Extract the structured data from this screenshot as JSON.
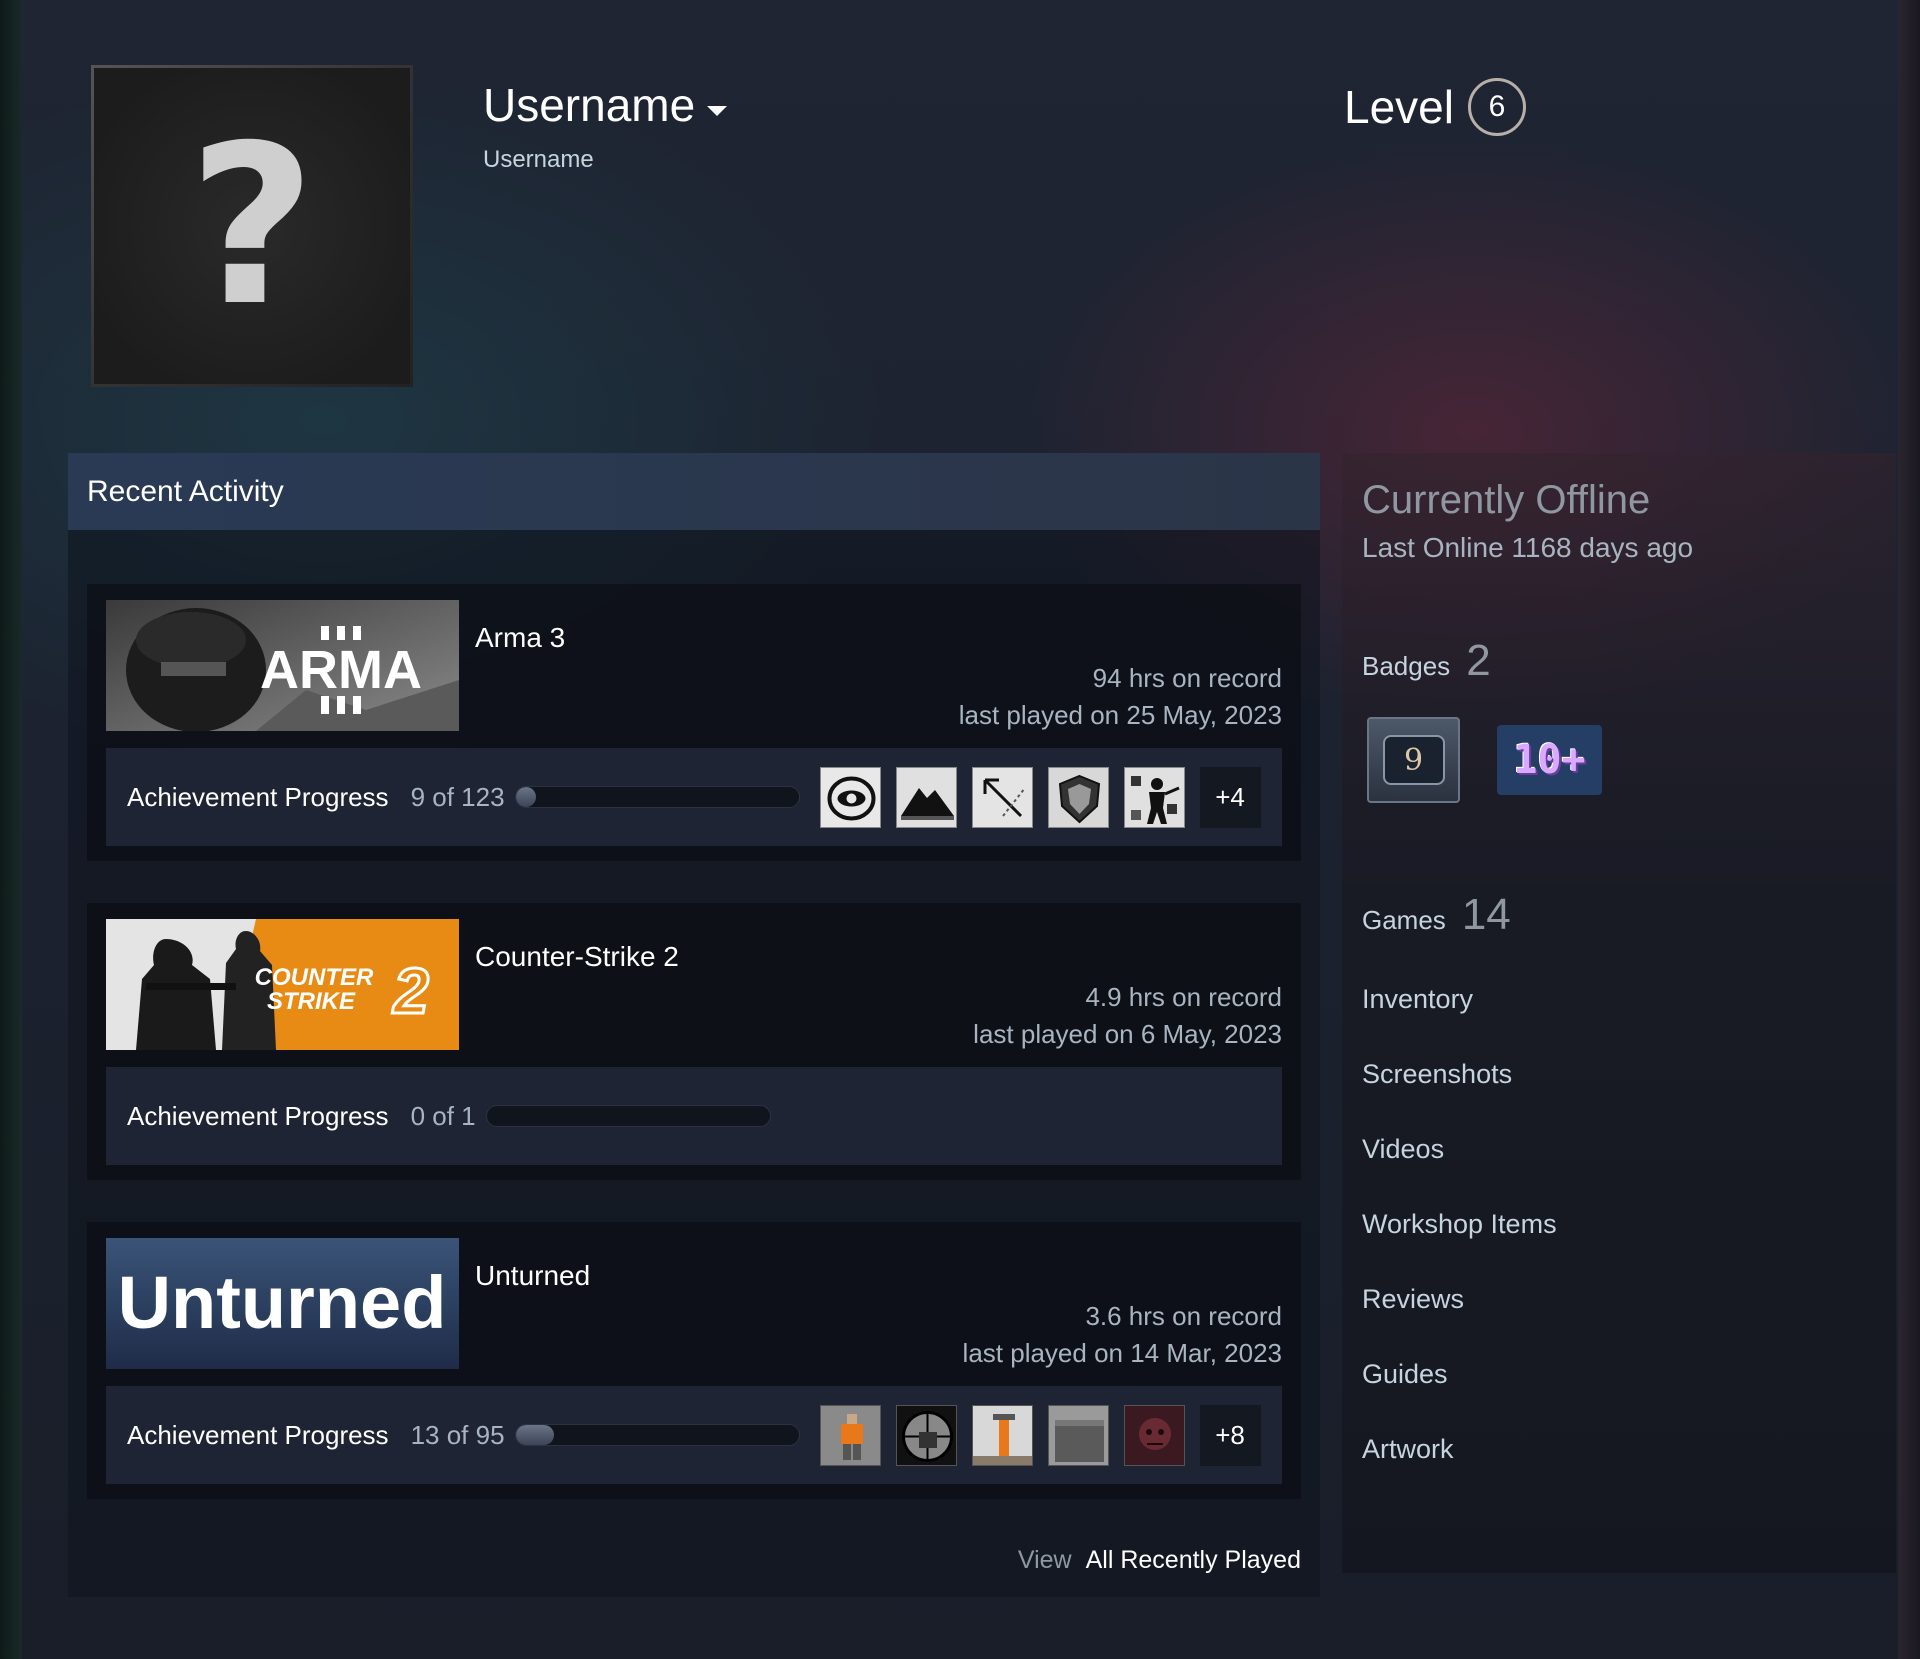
{
  "profile": {
    "persona_name": "Username",
    "real_name": "Username",
    "level_label": "Level",
    "level": "6",
    "avatar_glyph": "?"
  },
  "recent": {
    "title": "Recent Activity",
    "games": [
      {
        "name": "Arma 3",
        "hours": "94 hrs on record",
        "last_played": "last played on 25 May, 2023",
        "capsule_text": "ARMA III",
        "achievement_label": "Achievement Progress",
        "achievement_count": "9 of 123",
        "progress": 0.073,
        "more": "+4",
        "icons": [
          "eye-achievement-icon",
          "mountain-achievement-icon",
          "arrow-achievement-icon",
          "shield-achievement-icon",
          "soldier-achievement-icon"
        ]
      },
      {
        "name": "Counter-Strike 2",
        "hours": "4.9 hrs on record",
        "last_played": "last played on 6 May, 2023",
        "capsule_text": "COUNTER STRIKE 2",
        "achievement_label": "Achievement Progress",
        "achievement_count": "0 of 1",
        "progress": 0.0
      },
      {
        "name": "Unturned",
        "hours": "3.6 hrs on record",
        "last_played": "last played on 14 Mar, 2023",
        "capsule_text": "Unturned",
        "achievement_label": "Achievement Progress",
        "achievement_count": "13 of 95",
        "progress": 0.137,
        "more": "+8",
        "icons": [
          "orange-figure-achievement-icon",
          "crosshair-achievement-icon",
          "tower-achievement-icon",
          "wall-achievement-icon",
          "zombie-achievement-icon"
        ]
      }
    ],
    "view_label": "View",
    "view_all_label": "All Recently Played"
  },
  "sidebar": {
    "status": "Currently Offline",
    "last_online": "Last Online 1168 days ago",
    "badges_label": "Badges",
    "badges_count": "2",
    "badge1_value": "9",
    "badge2_value": "10+",
    "games_label": "Games",
    "games_count": "14",
    "links": [
      "Inventory",
      "Screenshots",
      "Videos",
      "Workshop Items",
      "Reviews",
      "Guides",
      "Artwork"
    ]
  },
  "colors": {
    "background": "#1b2029",
    "header_bar": "#2a3a55",
    "text_primary": "#ffffff",
    "text_secondary": "#a8b4c0",
    "cs2_orange": "#e88b14"
  }
}
